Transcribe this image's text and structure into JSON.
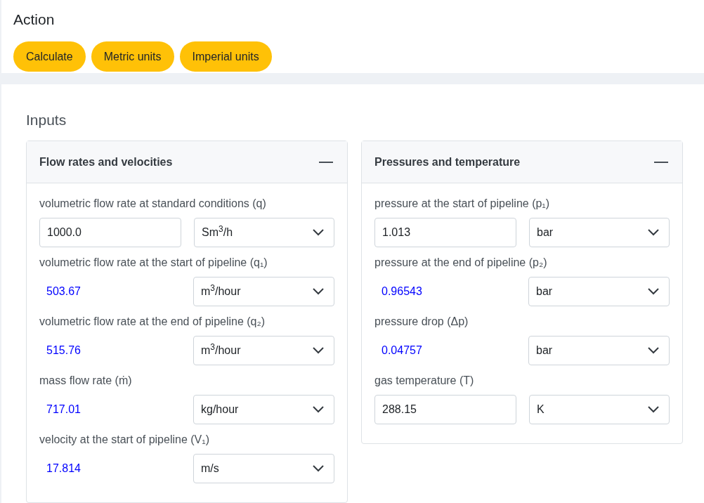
{
  "action": {
    "title": "Action",
    "buttons": [
      "Calculate",
      "Metric units",
      "Imperial units"
    ]
  },
  "inputs": {
    "title": "Inputs",
    "cards": [
      {
        "title": "Flow rates and velocities",
        "expanded": true,
        "rows": [
          {
            "label": "volumetric flow rate at standard conditions (q)",
            "kind": "input",
            "value": "1000.0",
            "unit": "Sm$^{3}$/h"
          },
          {
            "label": "volumetric flow rate at the start of pipeline (q₁)",
            "kind": "output",
            "value": "503.67",
            "unit": "m$^{3}$/hour"
          },
          {
            "label": "volumetric flow rate at the end of pipeline (q₂)",
            "kind": "output",
            "value": "515.76",
            "unit": "m$^{3}$/hour"
          },
          {
            "label": "mass flow rate (ṁ)",
            "kind": "output",
            "value": "717.01",
            "unit": "kg/hour"
          },
          {
            "label": "velocity at the start of pipeline (V₁)",
            "kind": "output",
            "value": "17.814",
            "unit": "m/s"
          }
        ]
      },
      {
        "title": "Pressures and temperature",
        "expanded": true,
        "rows": [
          {
            "label": "pressure at the start of pipeline (p₁)",
            "kind": "input",
            "value": "1.013",
            "unit": "bar"
          },
          {
            "label": "pressure at the end of pipeline (p₂)",
            "kind": "output",
            "value": "0.96543",
            "unit": "bar"
          },
          {
            "label": "pressure drop (Δp)",
            "kind": "output",
            "value": "0.04757",
            "unit": "bar"
          },
          {
            "label": "gas temperature (T)",
            "kind": "input",
            "value": "288.15",
            "unit": "K"
          }
        ]
      }
    ]
  }
}
